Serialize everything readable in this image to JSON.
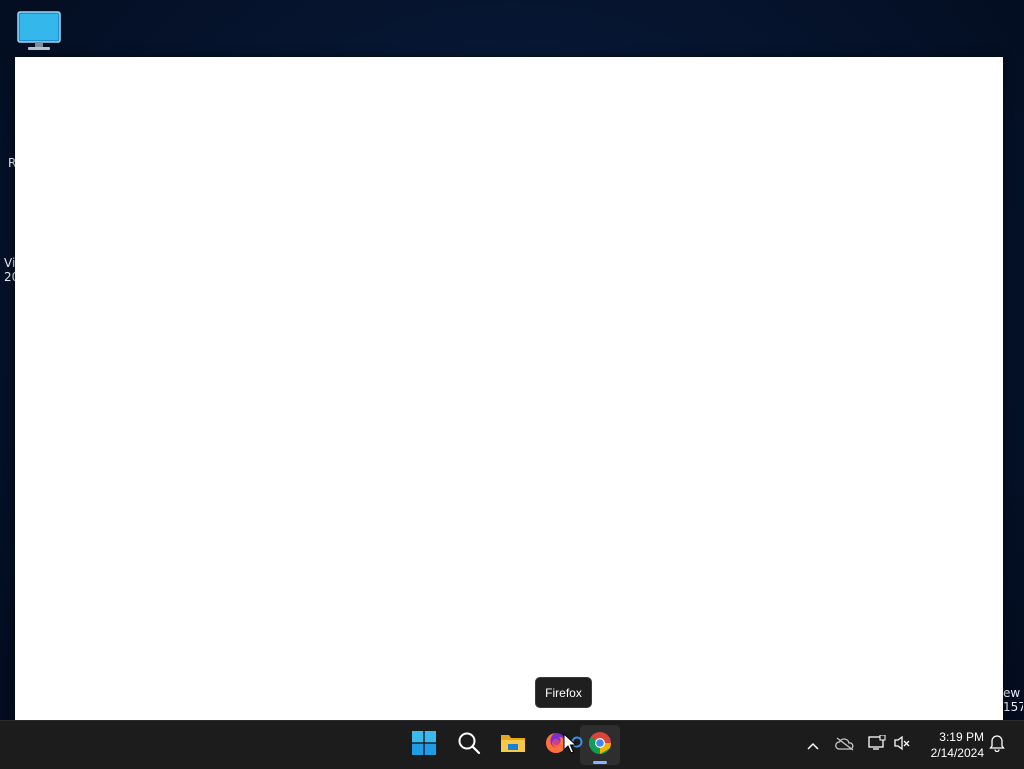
{
  "desktop": {
    "icons": [
      {
        "name": "This PC",
        "icon": "monitor-icon"
      }
    ],
    "edge_text_left": [
      "R",
      "Vi\n20"
    ],
    "edge_text_right": "ew\n157"
  },
  "tooltip": {
    "text": "Firefox"
  },
  "taskbar": {
    "apps": [
      {
        "name": "Start",
        "icon": "windows-start-icon"
      },
      {
        "name": "Search",
        "icon": "search-icon"
      },
      {
        "name": "File Explorer",
        "icon": "folder-icon"
      },
      {
        "name": "Firefox",
        "icon": "firefox-icon"
      },
      {
        "name": "Chrome",
        "icon": "chrome-icon",
        "active": true
      }
    ],
    "tray": {
      "icons": [
        "chevron-up-icon",
        "onedrive-offline-icon",
        "network-icon",
        "volume-muted-icon"
      ],
      "time": "3:19 PM",
      "date": "2/14/2024",
      "notification_icon": "bell-icon"
    }
  },
  "colors": {
    "taskbar_bg": "#1c1c1c",
    "window_bg": "#ffffff",
    "accent": "#8ab4f8"
  }
}
